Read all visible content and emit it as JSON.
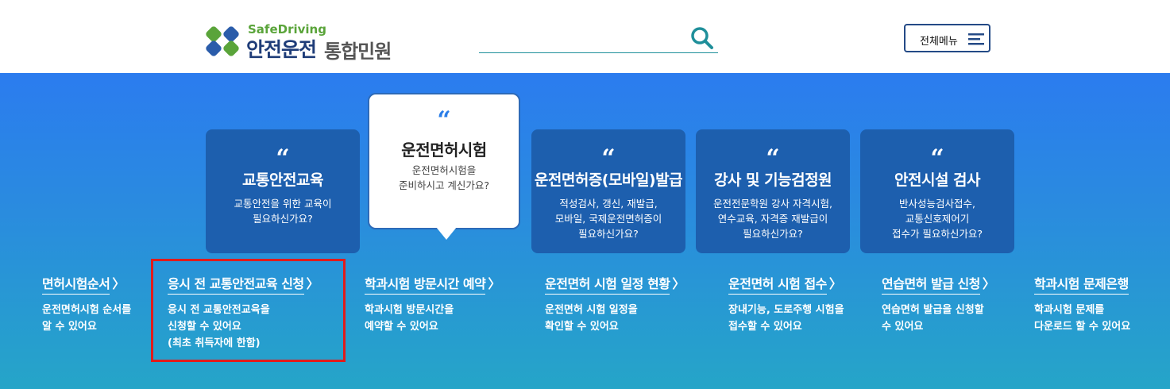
{
  "header": {
    "logo_small": "SafeDriving",
    "logo_main": "안전운전",
    "logo_sub": "통합민원",
    "menu_label": "전체메뉴"
  },
  "cards": [
    {
      "quote": "“",
      "title": "교통안전교육",
      "desc": [
        "교통안전을 위한 교육이",
        "필요하신가요?"
      ]
    },
    {
      "quote": "“",
      "title": "운전면허시험",
      "desc": [
        "운전면허시험을",
        "준비하시고 계신가요?"
      ]
    },
    {
      "quote": "“",
      "title": "운전면허증(모바일)발급",
      "desc": [
        "적성검사, 갱신, 재발급,",
        "모바일, 국제운전면허증이",
        "필요하신가요?"
      ]
    },
    {
      "quote": "“",
      "title": "강사 및 기능검정원",
      "desc": [
        "운전전문학원 강사 자격시험,",
        "연수교육, 자격증 재발급이",
        "필요하신가요?"
      ]
    },
    {
      "quote": "“",
      "title": "안전시설 검사",
      "desc": [
        "반사성능검사접수,",
        "교통신호제어기",
        "접수가 필요하신가요?"
      ]
    }
  ],
  "links": [
    {
      "title": "면허시험순서",
      "arrow": "〉",
      "desc": [
        "운전면허시험 순서를",
        "알 수 있어요"
      ]
    },
    {
      "title": "응시 전 교통안전교육 신청",
      "arrow": "〉",
      "desc": [
        "응시 전 교통안전교육을",
        "신청할 수 있어요",
        "(최초 취득자에 한함)"
      ]
    },
    {
      "title": "학과시험 방문시간 예약",
      "arrow": "〉",
      "desc": [
        "학과시험 방문시간을",
        "예약할 수 있어요"
      ]
    },
    {
      "title": "운전면허 시험 일정 현황",
      "arrow": "〉",
      "desc": [
        "운전면허 시험 일정을",
        "확인할 수 있어요"
      ]
    },
    {
      "title": "운전면허 시험 접수",
      "arrow": "〉",
      "desc": [
        "장내기능, 도로주행 시험을",
        "접수할 수 있어요"
      ]
    },
    {
      "title": "연습면허 발급 신청",
      "arrow": "〉",
      "desc": [
        "연습면허 발급을 신청할",
        "수 있어요"
      ]
    },
    {
      "title": "학과시험 문제은행",
      "arrow": "〉",
      "desc": [
        "학과시험 문제를",
        "다운로드 할 수 있어요"
      ]
    }
  ],
  "colors": {
    "accent": "#2b7cef",
    "card_bg": "#1d5fae",
    "highlight": "#e11b1b",
    "logo_green": "#5aa43a",
    "logo_navy": "#1e3c78"
  },
  "icons": {
    "logo": "clover-logo-icon",
    "search": "search-icon",
    "menu": "hamburger-menu-icon"
  }
}
